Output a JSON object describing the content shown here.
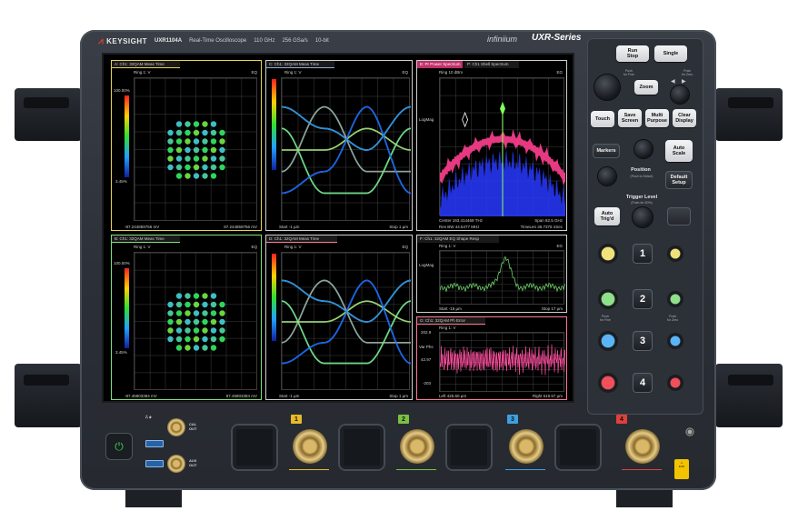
{
  "header": {
    "brand": "KEYSIGHT",
    "model": "UXR1104A",
    "specs": [
      "Real-Time Oscilloscope",
      "110 GHz",
      "256 GSa/s",
      "10-bit"
    ],
    "family": "infiniium",
    "series": "UXR-Series"
  },
  "panes": {
    "a": {
      "title": "A: Ch1: 32QAM Meas Time",
      "level": "Ring 1: V",
      "eg": "EQ",
      "top_pct": "100.00%",
      "bottom_pct": "3.45%",
      "left_val": "-87.244859756 mV",
      "right_val": "87.244859756 mV",
      "color": "#e8d44a"
    },
    "b": {
      "title": "B: Ch1: 32QAM Meas Time",
      "level": "Ring 1: V",
      "eg": "EQ",
      "top_pct": "100.00%",
      "bottom_pct": "3.45%",
      "left_val": "-87.45803384 mV",
      "right_val": "87.45803384 mV",
      "color": "#7ee07e"
    },
    "c": {
      "title": "C: Ch1: 32QAM Meas Time",
      "level": "Ring 1: V",
      "eg": "EQ",
      "left_val": "Start -1  µm",
      "right_val": "Stop 1  µm",
      "color": "#dcdcdc"
    },
    "d": {
      "title": "D: Ch1: 32QAM Meas Time",
      "level": "Ring 1: V",
      "eg": "EQ",
      "left_val": "Start -1  µm",
      "right_val": "Stop 1  µm",
      "color": "#ff7a9a"
    },
    "e": {
      "title_a": "E: Pr Power Spectrum",
      "title_b": "P: Ch1 Shell Spectrum",
      "level": "Ring 10 dBm",
      "eg": "EG",
      "scale": "LogMag",
      "left_val": "Center 193.414469 THz",
      "right_val": "Span 82.5 GHz",
      "left_val2": "Res BW 44.5477 MHz",
      "right_val2": "TimeLen 36.7375 nSec",
      "color": "#dcdcdc"
    },
    "f": {
      "title": "F: Ch1: 32QAM EQ Shape Resp",
      "level": "Ring 1: V",
      "eg": "EG",
      "scale": "LogMag",
      "left_val": "Start -15  µm",
      "right_val": "Stop 17  µm",
      "color": "#dcdcdc"
    },
    "g": {
      "title": "G: Ch1: 32QAM Ph Error",
      "level": "Ring 1: V",
      "scale": "Var Phs",
      "top_val": "202.9",
      "mid_val": "42.97",
      "bottom_val": "-203",
      "left_val": "Left 425.60  µm",
      "right_val": "Right 519.57  µm",
      "color": "#ff7a9a"
    }
  },
  "controls": {
    "run_stop": "Run\nStop",
    "single": "Single",
    "zoom": "Zoom",
    "touch": "Touch",
    "save_screen": "Save\nScreen",
    "multi_purpose": "Multi\nPurpose",
    "clear_display": "Clear\nDisplay",
    "markers": "Markers",
    "auto_scale": "Auto\nScale",
    "position": "Position",
    "position_sub": "(Push to Select)",
    "default_setup": "Default\nSetup",
    "trigger_level": "Trigger Level",
    "trigger_sub": "(Push for 50%)",
    "auto_trigd": "Auto\nTrig'd",
    "push_fine": "Push\nfor Fine",
    "push_zero": "Push\nfor Zero",
    "channels": [
      "1",
      "2",
      "3",
      "4"
    ],
    "channel_colors": [
      "#e6d65a",
      "#6fd06a",
      "#4aa6f0",
      "#e04a55"
    ]
  },
  "front": {
    "cal_out": "CAL\nOUT",
    "aux_out": "AUX\nOUT",
    "input_labels": [
      "1",
      "2",
      "3",
      "4"
    ],
    "input_colors": [
      "#e8b92a",
      "#79c142",
      "#3fa0e0",
      "#e0403a"
    ]
  }
}
